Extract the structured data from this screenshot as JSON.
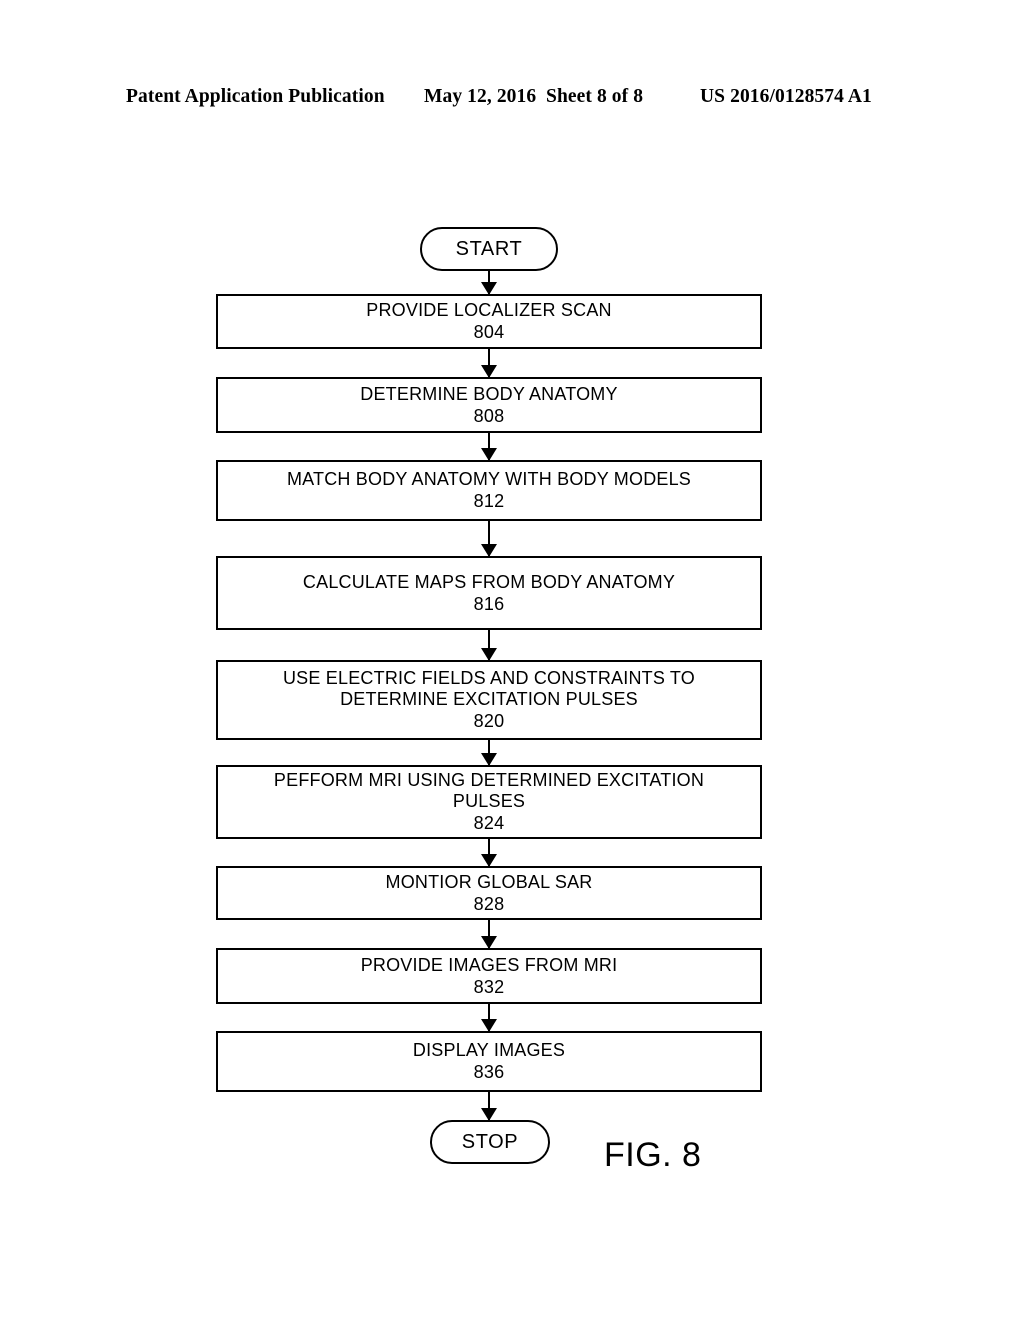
{
  "header": {
    "publication": "Patent Application Publication",
    "date": "May 12, 2016",
    "sheet": "Sheet 8 of 8",
    "patent_number": "US 2016/0128574 A1"
  },
  "figure": {
    "caption": "FIG. 8",
    "start_label": "START",
    "stop_label": "STOP",
    "steps": [
      {
        "text": "PROVIDE LOCALIZER SCAN",
        "ref": "804"
      },
      {
        "text": "DETERMINE BODY ANATOMY",
        "ref": "808"
      },
      {
        "text": "MATCH BODY ANATOMY WITH BODY MODELS",
        "ref": "812"
      },
      {
        "text": "CALCULATE MAPS FROM BODY ANATOMY",
        "ref": "816"
      },
      {
        "text": "USE ELECTRIC FIELDS AND CONSTRAINTS TO\nDETERMINE EXCITATION PULSES",
        "ref": "820"
      },
      {
        "text": "PEFFORM MRI USING DETERMINED EXCITATION\nPULSES",
        "ref": "824"
      },
      {
        "text": "MONTIOR GLOBAL SAR",
        "ref": "828"
      },
      {
        "text": "PROVIDE IMAGES FROM MRI",
        "ref": "832"
      },
      {
        "text": "DISPLAY IMAGES",
        "ref": "836"
      }
    ]
  },
  "colors": {
    "ink": "#000000",
    "paper": "#ffffff"
  }
}
